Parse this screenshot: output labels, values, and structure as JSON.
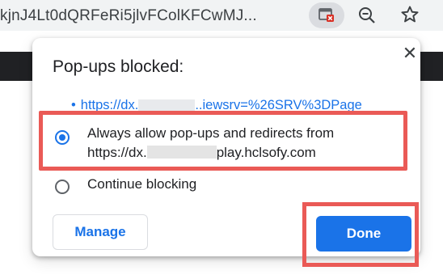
{
  "browser": {
    "url_partial": "kjnJ4Lt0dQRFeRi5jlvFColKFCwMJ...",
    "popup_indicator_icon": "popup-blocked-icon",
    "zoom_icon": "zoom-out-icon",
    "bookmark_icon": "star-icon"
  },
  "bubble": {
    "title": "Pop-ups blocked:",
    "close_label": "✕",
    "blocked_link": {
      "prefix": "https://dx.",
      "suffix": "..iewsrv=%26SRV%3DPage"
    },
    "options": {
      "allow": {
        "line1": "Always allow pop-ups and redirects from",
        "line2_prefix": "https://dx.",
        "line2_suffix": "play.hclsofy.com",
        "selected": true
      },
      "block": {
        "label": "Continue blocking",
        "selected": false
      }
    },
    "manage_label": "Manage",
    "done_label": "Done"
  },
  "colors": {
    "accent": "#1a73e8",
    "highlight": "#ea5a56"
  }
}
